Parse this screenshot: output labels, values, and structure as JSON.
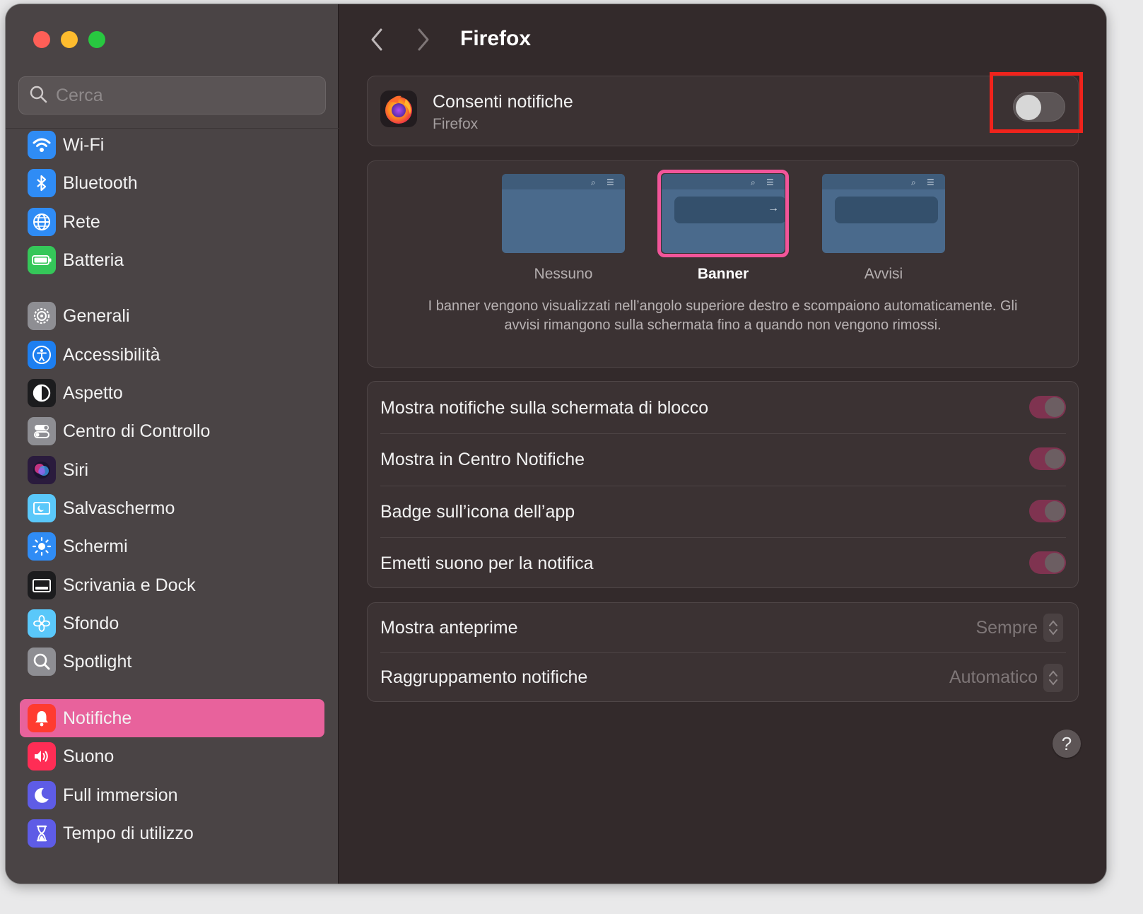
{
  "window": {
    "title": "Firefox"
  },
  "search": {
    "placeholder": "Cerca"
  },
  "sidebar": {
    "items": [
      {
        "label": "Wi-Fi",
        "icon": "wifi-icon",
        "color": "#2f8cf5"
      },
      {
        "label": "Bluetooth",
        "icon": "bluetooth-icon",
        "color": "#2f8cf5"
      },
      {
        "label": "Rete",
        "icon": "globe-icon",
        "color": "#2f8cf5"
      },
      {
        "label": "Batteria",
        "icon": "battery-icon",
        "color": "#35c759"
      },
      {
        "label": "Generali",
        "icon": "gear-icon",
        "color": "#8e8e93"
      },
      {
        "label": "Accessibilità",
        "icon": "accessibility-icon",
        "color": "#1d7ff0"
      },
      {
        "label": "Aspetto",
        "icon": "appearance-icon",
        "color": "#1c1c1e"
      },
      {
        "label": "Centro di Controllo",
        "icon": "control-center-icon",
        "color": "#8e8e93"
      },
      {
        "label": "Siri",
        "icon": "siri-icon",
        "color": "#2a1b3d"
      },
      {
        "label": "Salvaschermo",
        "icon": "screensaver-icon",
        "color": "#5ac8fa"
      },
      {
        "label": "Schermi",
        "icon": "brightness-icon",
        "color": "#2f8cf5"
      },
      {
        "label": "Scrivania e Dock",
        "icon": "dock-icon",
        "color": "#1c1c1e"
      },
      {
        "label": "Sfondo",
        "icon": "wallpaper-icon",
        "color": "#5ac8fa"
      },
      {
        "label": "Spotlight",
        "icon": "spotlight-icon",
        "color": "#8e8e93"
      },
      {
        "label": "Notifiche",
        "icon": "bell-icon",
        "color": "#ff3b30",
        "active": true
      },
      {
        "label": "Suono",
        "icon": "speaker-icon",
        "color": "#ff2d55"
      },
      {
        "label": "Full immersion",
        "icon": "moon-icon",
        "color": "#5e5ce6"
      },
      {
        "label": "Tempo di utilizzo",
        "icon": "hourglass-icon",
        "color": "#5e5ce6"
      }
    ]
  },
  "app": {
    "allow_label": "Consenti notifiche",
    "app_name": "Firefox",
    "allow_enabled": false
  },
  "alert_style": {
    "options": [
      {
        "label": "Nessuno",
        "selected": false
      },
      {
        "label": "Banner",
        "selected": true
      },
      {
        "label": "Avvisi",
        "selected": false
      }
    ],
    "description": "I banner vengono visualizzati nell’angolo superiore destro e scompaiono automaticamente. Gli avvisi rimangono sulla schermata fino a quando non vengono rimossi."
  },
  "options": [
    {
      "label": "Mostra notifiche sulla schermata di blocco",
      "enabled": true
    },
    {
      "label": "Mostra in Centro Notifiche",
      "enabled": true
    },
    {
      "label": "Badge sull’icona dell’app",
      "enabled": true
    },
    {
      "label": "Emetti suono per la notifica",
      "enabled": true
    }
  ],
  "selects": [
    {
      "label": "Mostra anteprime",
      "value": "Sempre"
    },
    {
      "label": "Raggruppamento notifiche",
      "value": "Automatico"
    }
  ],
  "help": {
    "label": "?"
  },
  "colors": {
    "accent_pink": "#e8629c",
    "highlight_red": "#f0231c"
  }
}
